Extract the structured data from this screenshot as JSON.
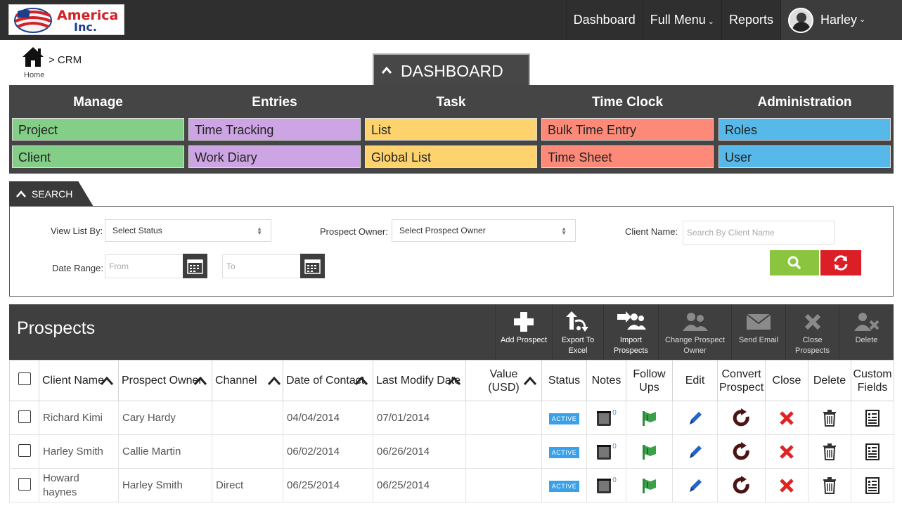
{
  "logo": {
    "line1": "America",
    "line2": "Inc."
  },
  "nav": {
    "dashboard": "Dashboard",
    "full_menu": "Full Menu",
    "reports": "Reports",
    "user": "Harley"
  },
  "breadcrumb": {
    "home": "Home",
    "path": "> CRM"
  },
  "dashboard": {
    "title": "DASHBOARD",
    "columns": [
      {
        "heading": "Manage",
        "links": [
          "Project",
          "Client"
        ],
        "color": "#84cf87"
      },
      {
        "heading": "Entries",
        "links": [
          "Time Tracking",
          "Work Diary"
        ],
        "color": "#cea5e4"
      },
      {
        "heading": "Task",
        "links": [
          "List",
          "Global List"
        ],
        "color": "#fed36e"
      },
      {
        "heading": "Time Clock",
        "links": [
          "Bulk Time Entry",
          "Time Sheet"
        ],
        "color": "#fd8a78"
      },
      {
        "heading": "Administration",
        "links": [
          "Roles",
          "User"
        ],
        "color": "#57b8ea"
      }
    ]
  },
  "search": {
    "title": "SEARCH",
    "view_list_label": "View List By:",
    "view_list_value": "Select Status",
    "owner_label": "Prospect Owner:",
    "owner_value": "Select Prospect Owner",
    "client_label": "Client Name:",
    "client_placeholder": "Search By Client Name",
    "date_label": "Date Range:",
    "from_placeholder": "From",
    "to_placeholder": "To"
  },
  "prospects": {
    "title": "Prospects",
    "tools": [
      {
        "label": "Add Prospect",
        "icon": "plus-icon"
      },
      {
        "label": "Export To Excel",
        "icon": "export-icon"
      },
      {
        "label": "Import Prospects",
        "icon": "import-icon"
      },
      {
        "label": "Change Prospect Owner",
        "icon": "users-icon"
      },
      {
        "label": "Send Email",
        "icon": "envelope-icon"
      },
      {
        "label": "Close Prospects",
        "icon": "x-icon"
      },
      {
        "label": "Delete",
        "icon": "user-delete-icon"
      }
    ],
    "columns": [
      "Client Name",
      "Prospect Owner",
      "Channel",
      "Date of Contact",
      "Last Modify Date",
      "Value (USD)",
      "Status",
      "Notes",
      "Follow Ups",
      "Edit",
      "Convert Prospect",
      "Close",
      "Delete",
      "Custom Fields"
    ],
    "rows": [
      {
        "client": "Richard Kimi",
        "owner": "Cary Hardy",
        "channel": "",
        "contact": "04/04/2014",
        "modified": "07/01/2014",
        "value": "",
        "status": "ACTIVE",
        "notes": "0"
      },
      {
        "client": "Harley Smith",
        "owner": "Callie Martin",
        "channel": "",
        "contact": "06/02/2014",
        "modified": "06/26/2014",
        "value": "",
        "status": "ACTIVE",
        "notes": "0"
      },
      {
        "client": "Howard haynes",
        "owner": "Harley Smith",
        "channel": "Direct",
        "contact": "06/25/2014",
        "modified": "06/25/2014",
        "value": "",
        "status": "ACTIVE",
        "notes": "0"
      }
    ]
  }
}
